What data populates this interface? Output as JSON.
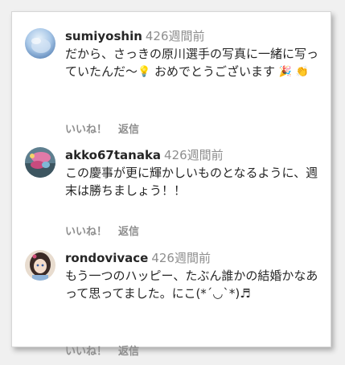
{
  "comments": [
    {
      "username": "sumiyoshin",
      "time": "426週間前",
      "text_a": "だから、さっきの原川選手の写真に一緒に写っていたんだ〜",
      "emoji_a": "💡",
      "text_b": " おめでとうございます",
      "emoji_b": "🎉",
      "emoji_c": "👏",
      "like_label": "いいね！",
      "reply_label": "返信"
    },
    {
      "username": "akko67tanaka",
      "time": "426週間前",
      "text": "この慶事が更に輝かしいものとなるように、週末は勝ちましょう！！",
      "like_label": "いいね！",
      "reply_label": "返信"
    },
    {
      "username": "rondovivace",
      "time": "426週間前",
      "text": "もう一つのハッピー、たぶん誰かの結婚かなあって思ってました。にこ(*ˊ◡ˋ*)♬",
      "like_label": "いいね！",
      "reply_label": "返信"
    }
  ]
}
